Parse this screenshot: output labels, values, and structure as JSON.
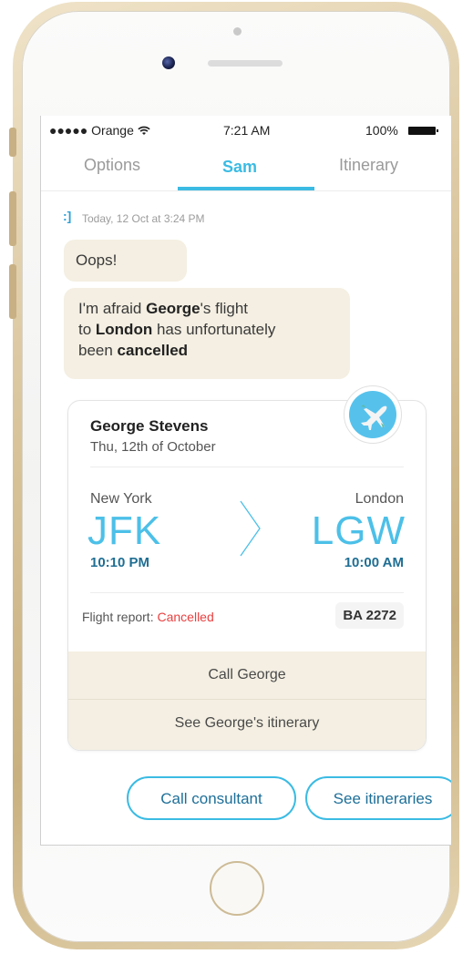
{
  "status_bar": {
    "carrier": "●●●●● Orange",
    "time": "7:21 AM",
    "battery": "100%"
  },
  "tabs": [
    {
      "label": "Options"
    },
    {
      "label": "Sam"
    },
    {
      "label": "Itinerary"
    }
  ],
  "chat": {
    "timestamp": "Today, 12 Oct at 3:24 PM",
    "message1": "Oops!",
    "message2": {
      "line1_pre": "I'm afraid ",
      "line1_bold": "George",
      "line1_post": "'s flight",
      "line2_pre": "to ",
      "line2_bold": "London",
      "line2_post": " has unfortunately",
      "line3_pre": "been ",
      "line3_bold": "cancelled"
    }
  },
  "flight_card": {
    "passenger": "George Stevens",
    "date": "Thu, 12th of October",
    "from_city": "New York",
    "from_code": "JFK",
    "from_time": "10:10 PM",
    "to_city": "London",
    "to_code": "LGW",
    "to_time": "10:00 AM",
    "report_label": "Flight report: ",
    "report_status": "Cancelled",
    "flight_number": "BA 2272",
    "action_call": "Call George",
    "action_itinerary": "See George's itinerary"
  },
  "quick_actions": {
    "call_consultant": "Call consultant",
    "see_itineraries": "See itineraries"
  },
  "colors": {
    "accent": "#3bbbe3",
    "bubble": "#f4efe2",
    "cancelled": "#e94040"
  }
}
